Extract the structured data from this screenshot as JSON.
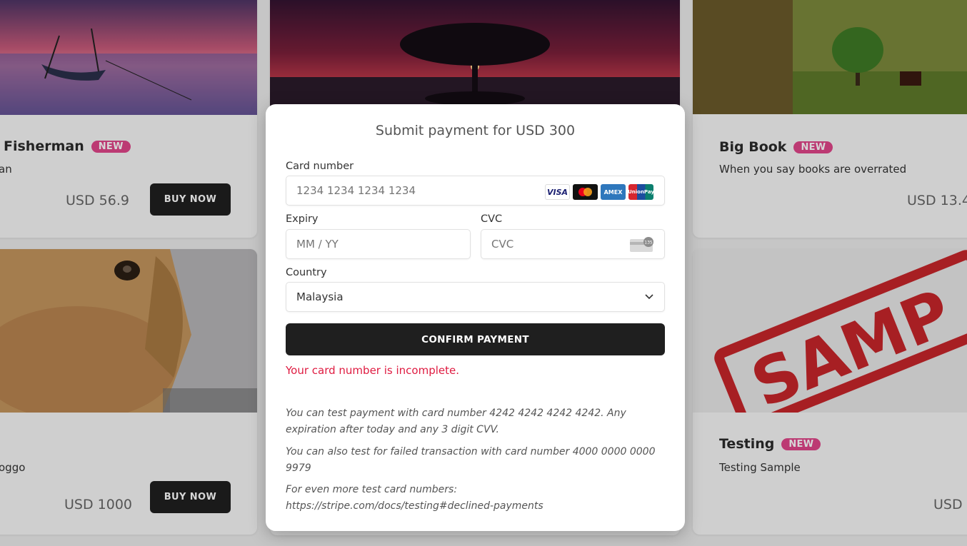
{
  "products": [
    {
      "title": "Fisherman",
      "badge": "NEW",
      "desc": "an",
      "price": "USD 56.9",
      "button": "BUY NOW"
    },
    {
      "title": "Big Book",
      "badge": "NEW",
      "desc": "When you say books are overrated",
      "price": "USD 13.4"
    },
    {
      "title": "",
      "badge": "",
      "desc": "oggo",
      "price": "USD 1000",
      "button": "BUY NOW"
    },
    {
      "title": "Testing",
      "badge": "NEW",
      "desc": "Testing Sample",
      "price": "USD",
      "stamp": "SAMP"
    }
  ],
  "modal": {
    "title": "Submit payment for USD 300",
    "card_number": {
      "label": "Card number",
      "placeholder": "1234 1234 1234 1234",
      "brands": [
        "VISA",
        "mastercard-icon",
        "AMEX",
        "UnionPay"
      ]
    },
    "expiry": {
      "label": "Expiry",
      "placeholder": "MM / YY"
    },
    "cvc": {
      "label": "CVC",
      "placeholder": "CVC",
      "icon_text": "135"
    },
    "country": {
      "label": "Country",
      "value": "Malaysia"
    },
    "confirm_label": "CONFIRM PAYMENT",
    "error": "Your card number is incomplete.",
    "notes": [
      "You can test payment with card number 4242 4242 4242 4242. Any expiration after today and any 3 digit CVV.",
      "You can also test for failed transaction with card number 4000 0000 0000 9979",
      "For even more test card numbers: https://stripe.com/docs/testing#declined-payments"
    ]
  },
  "colors": {
    "badge": "#e0468a",
    "button": "#1f1f1f",
    "error": "#df1b41"
  }
}
